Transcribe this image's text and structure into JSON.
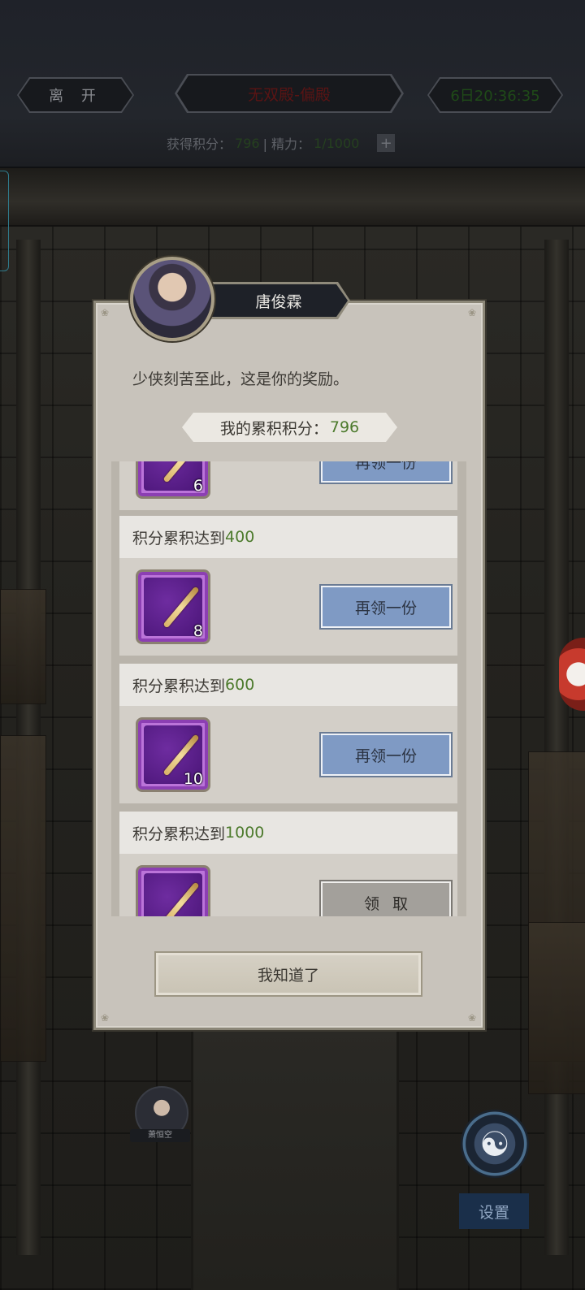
{
  "topbar": {
    "leave_label": "离 开",
    "title": "无双殿-偏殿",
    "timer": "6日20:36:35",
    "points_label": "获得积分：",
    "points_value": "796",
    "energy_label": "| 精力：",
    "energy_value": "1/1000",
    "plus_label": "+"
  },
  "dialog": {
    "npc_name": "唐俊霖",
    "message": "少侠刻苦至此，这是你的奖励。",
    "score_label": "我的累积积分：",
    "score_value": "796",
    "rewards": [
      {
        "count": "6",
        "button": "再领一份"
      },
      {
        "label": "积分累积达到",
        "goal": "400",
        "count": "8",
        "button": "再领一份"
      },
      {
        "label": "积分累积达到",
        "goal": "600",
        "count": "10",
        "button": "再领一份"
      },
      {
        "label": "积分累积达到",
        "goal": "1000",
        "count": "",
        "button": "领取"
      }
    ],
    "confirm_label": "我知道了"
  },
  "bottom": {
    "hero_name": "萧恒空",
    "settings_label": "设置"
  },
  "colors": {
    "goal_green": "#4c7a2c",
    "button_blue": "#7f9ac4",
    "button_grey": "#a3a09b",
    "item_purple": "#bb74d9"
  },
  "icons": [
    "taiji-icon",
    "staff-icon",
    "plus-icon"
  ]
}
